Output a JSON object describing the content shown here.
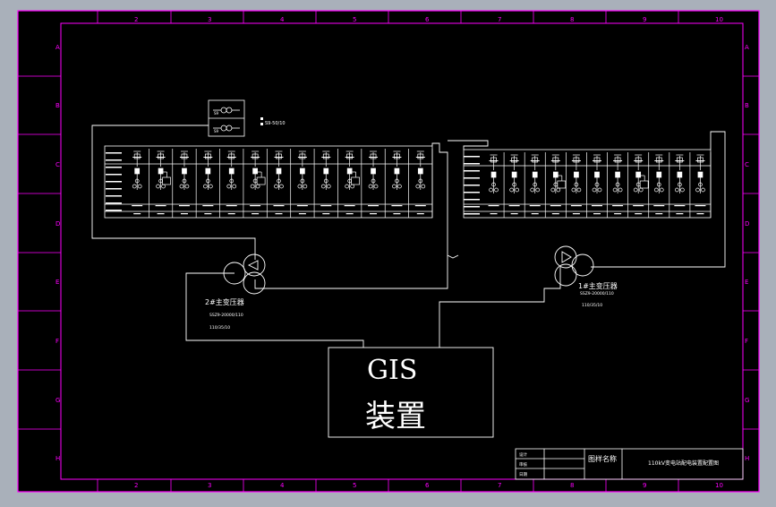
{
  "frame": {
    "columns": [
      "2",
      "3",
      "4",
      "5",
      "6",
      "7",
      "8",
      "9",
      "10"
    ],
    "rows": [
      "A",
      "B",
      "C",
      "D",
      "E",
      "F",
      "G",
      "H"
    ]
  },
  "transformer_left": {
    "name": "2#主变压器",
    "model": "SSZ9-20000/110",
    "voltage": "110/35/10"
  },
  "transformer_right": {
    "name": "1#主变压器",
    "model": "SSZ9-20000/110",
    "voltage": "110/35/10"
  },
  "station_transformer_label": "S9-50/10",
  "gis": {
    "line1": "GIS",
    "line2": "装置"
  },
  "title_block": {
    "drawing_name_label": "图样名称",
    "drawing_title": "110kV变电站配电装置配置图",
    "row_labels": [
      "设计",
      "审核",
      "日期"
    ]
  },
  "colors": {
    "background": "#000000",
    "frame": "#ff00ff",
    "lines": "#ffffff",
    "outer": "#a9b0ba"
  }
}
